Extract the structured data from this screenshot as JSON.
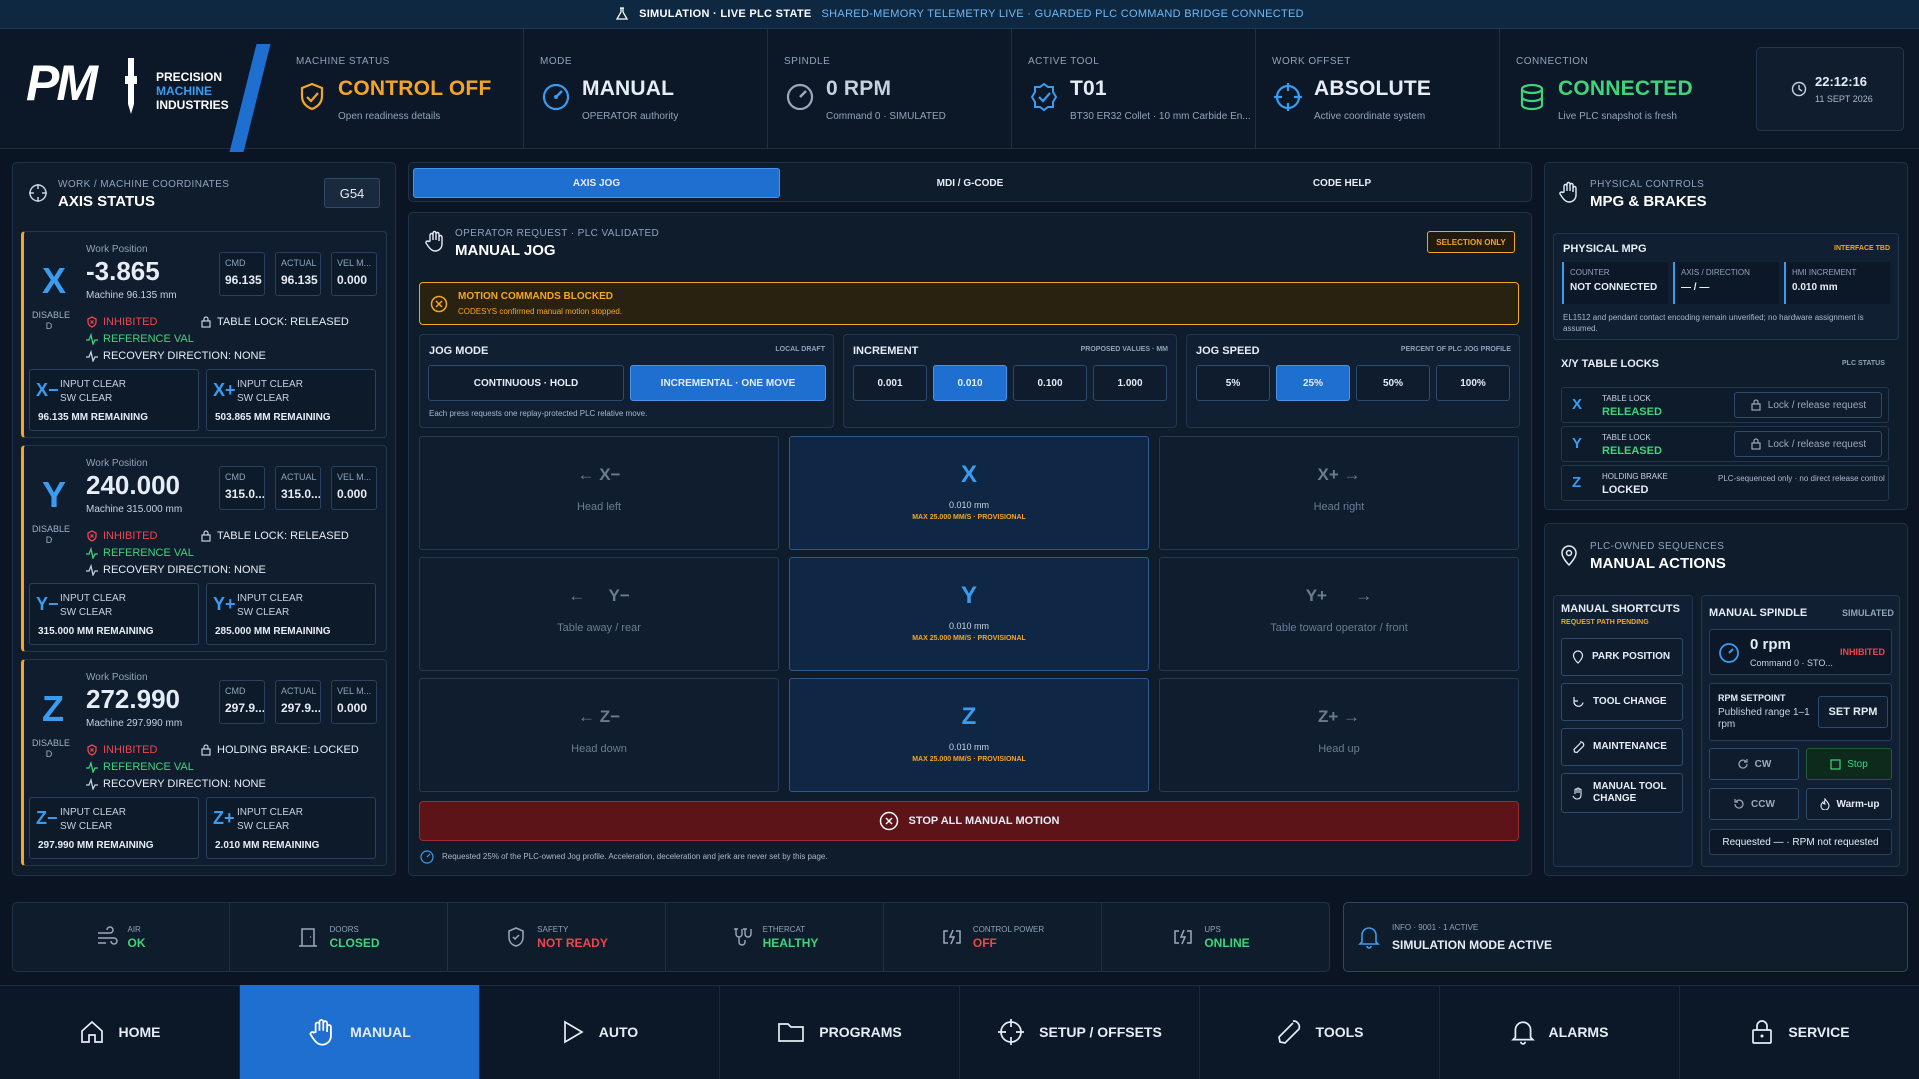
{
  "banner": {
    "simulation": "SIMULATION · LIVE PLC STATE",
    "telemetry": "SHARED-MEMORY TELEMETRY LIVE · GUARDED PLC COMMAND BRIDGE CONNECTED"
  },
  "brand": {
    "short": "PM",
    "line1": "PRECISION",
    "line2": "MACHINE",
    "line3": "INDUSTRIES"
  },
  "header": [
    {
      "label": "MACHINE STATUS",
      "value": "CONTROL OFF",
      "sub": "Open readiness details",
      "color": "#f5a524",
      "icon": "shield-icon"
    },
    {
      "label": "MODE",
      "value": "MANUAL",
      "sub": "OPERATOR authority",
      "color": "#ffffff",
      "icon": "gauge-icon"
    },
    {
      "label": "SPINDLE",
      "value": "0 RPM",
      "sub": "Command 0 · SIMULATED",
      "color": "#c6d2e0",
      "icon": "spindle-gauge-icon"
    },
    {
      "label": "ACTIVE TOOL",
      "value": "T01",
      "sub": "BT30 ER32 Collet · 10 mm Carbide En...",
      "color": "#ffffff",
      "icon": "tool-badge-icon"
    },
    {
      "label": "WORK OFFSET",
      "value": "ABSOLUTE",
      "sub": "Active coordinate system",
      "color": "#ffffff",
      "icon": "crosshair-icon"
    },
    {
      "label": "CONNECTION",
      "value": "CONNECTED",
      "sub": "Live PLC snapshot is fresh",
      "color": "#3fd47b",
      "icon": "database-icon"
    }
  ],
  "clock": {
    "time": "22:12:16",
    "date": "11 SEPT 2026"
  },
  "axis_panel": {
    "subtitle": "WORK / MACHINE COORDINATES",
    "title": "AXIS STATUS",
    "offset": "G54"
  },
  "axes": [
    {
      "letter": "X",
      "state": "DISABLE D",
      "wp_label": "Work Position",
      "pos": "-3.865",
      "machine": "Machine 96.135 mm",
      "cmd_label": "CMD",
      "cmd": "96.135",
      "act_label": "ACTUAL",
      "act": "96.135",
      "vel_label": "VEL M...",
      "vel": "0.000",
      "inhibited": "INHIBITED",
      "ref": "REFERENCE VAL",
      "recovery": "RECOVERY DIRECTION: NONE",
      "lock": "TABLE LOCK: RELEASED",
      "minus_sym": "X−",
      "plus_sym": "X+",
      "minus_a": "INPUT CLEAR",
      "minus_b": "SW CLEAR",
      "minus_rem": "96.135 MM REMAINING",
      "plus_a": "INPUT CLEAR",
      "plus_b": "SW CLEAR",
      "plus_rem": "503.865 MM REMAINING"
    },
    {
      "letter": "Y",
      "state": "DISABLE D",
      "wp_label": "Work Position",
      "pos": "240.000",
      "machine": "Machine 315.000 mm",
      "cmd_label": "CMD",
      "cmd": "315.0...",
      "act_label": "ACTUAL",
      "act": "315.0...",
      "vel_label": "VEL M...",
      "vel": "0.000",
      "inhibited": "INHIBITED",
      "ref": "REFERENCE VAL",
      "recovery": "RECOVERY DIRECTION: NONE",
      "lock": "TABLE LOCK: RELEASED",
      "minus_sym": "Y−",
      "plus_sym": "Y+",
      "minus_a": "INPUT CLEAR",
      "minus_b": "SW CLEAR",
      "minus_rem": "315.000 MM REMAINING",
      "plus_a": "INPUT CLEAR",
      "plus_b": "SW CLEAR",
      "plus_rem": "285.000 MM REMAINING"
    },
    {
      "letter": "Z",
      "state": "DISABLE D",
      "wp_label": "Work Position",
      "pos": "272.990",
      "machine": "Machine 297.990 mm",
      "cmd_label": "CMD",
      "cmd": "297.9...",
      "act_label": "ACTUAL",
      "act": "297.9...",
      "vel_label": "VEL M...",
      "vel": "0.000",
      "inhibited": "INHIBITED",
      "ref": "REFERENCE VAL",
      "recovery": "RECOVERY DIRECTION: NONE",
      "lock": "HOLDING BRAKE: LOCKED",
      "minus_sym": "Z−",
      "plus_sym": "Z+",
      "minus_a": "INPUT CLEAR",
      "minus_b": "SW CLEAR",
      "minus_rem": "297.990 MM REMAINING",
      "plus_a": "INPUT CLEAR",
      "plus_b": "SW CLEAR",
      "plus_rem": "2.010 MM REMAINING"
    }
  ],
  "tabs": [
    "AXIS JOG",
    "MDI / G-CODE",
    "CODE HELP"
  ],
  "jog": {
    "subtitle": "OPERATOR REQUEST · PLC VALIDATED",
    "title": "MANUAL JOG",
    "badge": "SELECTION ONLY",
    "alert_title": "MOTION COMMANDS BLOCKED",
    "alert_sub": "CODESYS confirmed manual motion stopped.",
    "mode_label": "JOG MODE",
    "mode_note": "LOCAL DRAFT",
    "modes": [
      "CONTINUOUS · HOLD",
      "INCREMENTAL · ONE MOVE"
    ],
    "mode_hint": "Each press requests one replay-protected PLC relative move.",
    "inc_label": "INCREMENT",
    "inc_note": "PROPOSED VALUES · MM",
    "increments": [
      "0.001",
      "0.010",
      "0.100",
      "1.000"
    ],
    "speed_label": "JOG SPEED",
    "speed_note": "PERCENT OF PLC JOG PROFILE",
    "speeds": [
      "5%",
      "25%",
      "50%",
      "100%"
    ],
    "rows": [
      {
        "minus": "X−",
        "minus_hint": "Head left",
        "axis": "X",
        "step": "0.010 mm",
        "max": "MAX 25.000 MM/S · PROVISIONAL",
        "plus": "X+",
        "plus_hint": "Head right"
      },
      {
        "minus": "Y−",
        "minus_hint": "Table away / rear",
        "axis": "Y",
        "step": "0.010 mm",
        "max": "MAX 25.000 MM/S · PROVISIONAL",
        "plus": "Y+",
        "plus_hint": "Table toward operator / front"
      },
      {
        "minus": "Z−",
        "minus_hint": "Head down",
        "axis": "Z",
        "step": "0.010 mm",
        "max": "MAX 25.000 MM/S · PROVISIONAL",
        "plus": "Z+",
        "plus_hint": "Head up"
      }
    ],
    "stop": "STOP ALL MANUAL MOTION",
    "footnote": "Requested 25% of the PLC-owned Jog profile. Acceleration, deceleration and jerk are never set by this page."
  },
  "mpg": {
    "subtitle": "PHYSICAL CONTROLS",
    "title": "MPG & BRAKES",
    "phys_title": "PHYSICAL MPG",
    "phys_badge": "INTERFACE TBD",
    "counter_k": "COUNTER",
    "counter_v": "NOT CONNECTED",
    "axisdir_k": "AXIS / DIRECTION",
    "axisdir_v": "— / —",
    "hmi_k": "HMI INCREMENT",
    "hmi_v": "0.010 mm",
    "note": "EL1512 and pendant contact encoding remain unverified; no hardware assignment is assumed.",
    "locks_title": "X/Y TABLE LOCKS",
    "locks_badge": "PLC STATUS",
    "locks": [
      {
        "axis": "X",
        "k": "TABLE LOCK",
        "v": "RELEASED",
        "action": "Lock / release request"
      },
      {
        "axis": "Y",
        "k": "TABLE LOCK",
        "v": "RELEASED",
        "action": "Lock / release request"
      }
    ],
    "brake": {
      "axis": "Z",
      "k": "HOLDING BRAKE",
      "v": "LOCKED",
      "note": "PLC-sequenced only · no direct release control"
    }
  },
  "actions": {
    "subtitle": "PLC-OWNED SEQUENCES",
    "title": "MANUAL ACTIONS",
    "shortcuts_title": "MANUAL SHORTCUTS",
    "shortcuts_note": "REQUEST PATH PENDING",
    "shortcuts": [
      "PARK POSITION",
      "TOOL CHANGE",
      "MAINTENANCE",
      "MANUAL TOOL CHANGE"
    ],
    "spindle_title": "MANUAL SPINDLE",
    "spindle_badge": "SIMULATED",
    "rpm": "0 rpm",
    "rpm_sub": "Command 0 · STO...",
    "inhibited": "INHIBITED",
    "setpoint_k": "RPM SETPOINT",
    "setpoint_sub": "Published range 1–1 rpm",
    "set_btn": "SET RPM",
    "cw": "CW",
    "stop": "Stop",
    "ccw": "CCW",
    "warmup": "Warm-up",
    "requested": "Requested — · RPM not requested"
  },
  "statusbar": [
    {
      "k": "AIR",
      "v": "OK",
      "color": "#3fd47b",
      "icon": "air-flow-icon"
    },
    {
      "k": "DOORS",
      "v": "CLOSED",
      "color": "#3fd47b",
      "icon": "door-icon"
    },
    {
      "k": "SAFETY",
      "v": "NOT READY",
      "color": "#f0454b",
      "icon": "safety-shield-icon"
    },
    {
      "k": "ETHERCAT",
      "v": "HEALTHY",
      "color": "#3fd47b",
      "icon": "ethercat-plug-icon"
    },
    {
      "k": "CONTROL POWER",
      "v": "OFF",
      "color": "#f0454b",
      "icon": "power-bolt-icon"
    },
    {
      "k": "UPS",
      "v": "ONLINE",
      "color": "#3fd47b",
      "icon": "ups-bolt-icon"
    }
  ],
  "alarm": {
    "k": "INFO · 9001 · 1 ACTIVE",
    "v": "SIMULATION MODE ACTIVE"
  },
  "nav": [
    {
      "label": "HOME",
      "icon": "home-icon"
    },
    {
      "label": "MANUAL",
      "icon": "hand-icon"
    },
    {
      "label": "AUTO",
      "icon": "play-icon"
    },
    {
      "label": "PROGRAMS",
      "icon": "folder-icon"
    },
    {
      "label": "SETUP / OFFSETS",
      "icon": "crosshair-icon"
    },
    {
      "label": "TOOLS",
      "icon": "wrench-icon"
    },
    {
      "label": "ALARMS",
      "icon": "bell-icon"
    },
    {
      "label": "SERVICE",
      "icon": "padlock-icon"
    }
  ]
}
